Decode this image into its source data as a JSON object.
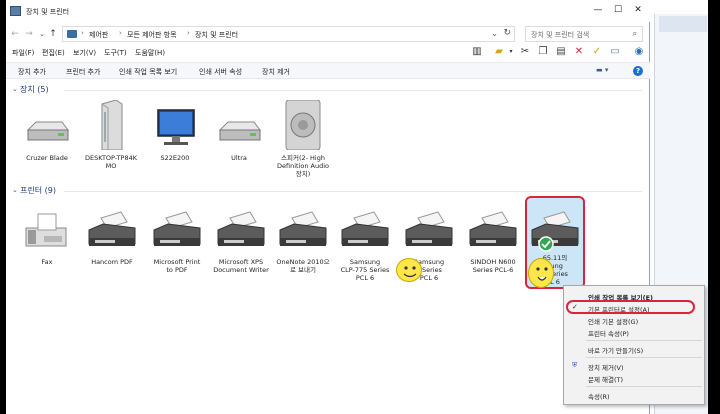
{
  "window": {
    "title": "장치 및 프린터",
    "controls": {
      "minimize": "—",
      "maximize": "☐",
      "close": "✕"
    }
  },
  "address": {
    "back": "←",
    "forward": "→",
    "up": "↑",
    "crumbs": [
      "제어판",
      "모든 제어판 항목",
      "장치 및 프린터"
    ],
    "separator": "›",
    "search_placeholder": "장치 및 프린터 검색"
  },
  "menu": [
    "파일(F)",
    "편집(E)",
    "보기(V)",
    "도구(T)",
    "도움말(H)"
  ],
  "commands": [
    "장치 추가",
    "프린터 추가",
    "인쇄 작업 목록 보기",
    "인쇄 서버 속성",
    "장치 제거"
  ],
  "groups": {
    "devices": {
      "title": "장치 (5)"
    },
    "printers": {
      "title": "프린터 (9)"
    }
  },
  "devices": [
    {
      "label": "Cruzer Blade",
      "icon": "usb-drive-icon"
    },
    {
      "label": "DESKTOP-TP84K\nMO",
      "icon": "computer-tower-icon"
    },
    {
      "label": "S22E200",
      "icon": "monitor-icon"
    },
    {
      "label": "Ultra",
      "icon": "usb-drive-icon"
    },
    {
      "label": "스피커(2- High\nDefinition Audio\n장치)",
      "icon": "speaker-icon"
    }
  ],
  "printers": [
    {
      "label": "Fax",
      "icon": "fax-icon"
    },
    {
      "label": "Hancom PDF",
      "icon": "printer-icon"
    },
    {
      "label": "Microsoft Print\nto PDF",
      "icon": "printer-icon"
    },
    {
      "label": "Microsoft XPS\nDocument Writer",
      "icon": "printer-icon"
    },
    {
      "label": "OneNote 2010으\n로 보내기",
      "icon": "printer-icon"
    },
    {
      "label": "Samsung\nCLP-775 Series\nPCL 6",
      "icon": "printer-icon"
    },
    {
      "label": "Samsung\nx Series\nPCL 6",
      "icon": "printer-icon"
    },
    {
      "label": "SINDOH N600\nSeries PCL-6",
      "icon": "printer-icon"
    },
    {
      "label": "65.11의\nsung\nx Series\nL 6",
      "icon": "printer-icon",
      "selected": true,
      "default": true
    }
  ],
  "context_menu": [
    {
      "label": "인쇄 작업 목록 보기(E)",
      "bold": true
    },
    {
      "label": "기본 프린터로 설정(A)",
      "checked": true
    },
    {
      "label": "인쇄 기본 설정(G)"
    },
    {
      "label": "프린터 속성(P)"
    },
    {
      "separator": true
    },
    {
      "label": "바로 가기 만들기(S)"
    },
    {
      "separator": true
    },
    {
      "label": "장치 제거(V)",
      "shield": true
    },
    {
      "label": "문제 해결(T)"
    },
    {
      "separator": true
    },
    {
      "label": "속성(R)"
    }
  ],
  "colors": {
    "accent": "#1e3a75",
    "highlight_outline": "#d6263b",
    "selection_fill": "#cde6f7"
  }
}
